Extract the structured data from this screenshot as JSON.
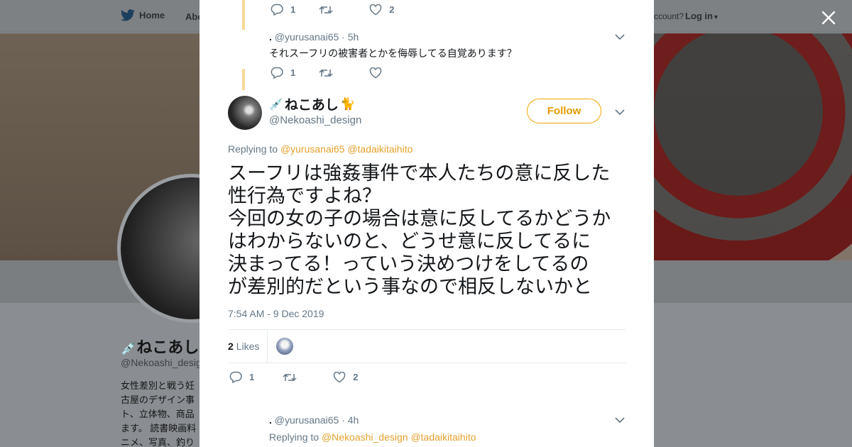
{
  "nav": {
    "home_label": "Home",
    "about_label": "Abo",
    "account_text": "ccount?",
    "login_label": "Log in"
  },
  "background_profile": {
    "name": "ねこあし",
    "handle": "@Nekoashi_desig",
    "bio_lines": [
      "女性差別と戦う妊",
      "古屋のデザイン事",
      "ト、立体物、商品",
      "ます。 読書映画料",
      "ニメ、写真、釣り"
    ]
  },
  "thread": {
    "prev_tweet_1": {
      "reply_count": "1",
      "like_count": "2"
    },
    "prev_tweet_2": {
      "author_name": ".",
      "author_handle": "@yurusanai65",
      "time": "5h",
      "text": "それスーフリの被害者とかを侮辱してる自覚あります？",
      "reply_count": "1"
    },
    "main_tweet": {
      "author_name": "ねこあし",
      "author_handle": "@Nekoashi_design",
      "follow_label": "Follow",
      "replying_to_label": "Replying to",
      "mentions": [
        "@yurusanai65",
        "@tadaikitaihito"
      ],
      "text_lines": [
        "スーフリは強姦事件で本人たちの意に反した",
        "性行為ですよね？",
        "今回の女の子の場合は意に反してるかどうか",
        "はわからないのと、どうせ意に反してるに",
        "決まってる！っていう決めつけをしてるの",
        "が差別的だという事なので相反しないかと"
      ],
      "timestamp": "7:54 AM - 9 Dec 2019",
      "likes_count": "2",
      "likes_label": "Likes",
      "reply_count": "1",
      "like_count": "2"
    },
    "next_tweet": {
      "author_name": ".",
      "author_handle": "@yurusanai65",
      "time": "4h",
      "replying_to_label": "Replying to",
      "mentions": [
        "@Nekoashi_design",
        "@tadaikitaihito"
      ]
    }
  },
  "colors": {
    "accent": "#e4a12b",
    "follow_border": "#f0a500",
    "muted_text": "#657786",
    "thread_line": "#f8d898"
  }
}
